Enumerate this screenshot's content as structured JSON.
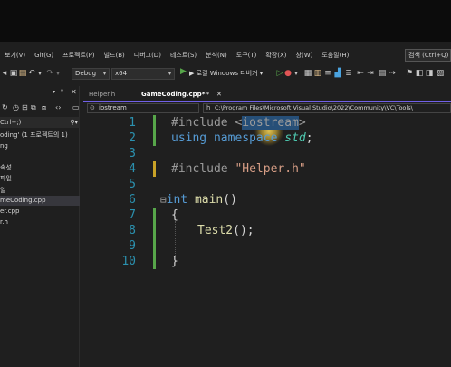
{
  "menubar": {
    "items": [
      "보기(V)",
      "Git(G)",
      "프로젝트(P)",
      "빌드(B)",
      "디버그(D)",
      "테스트(S)",
      "분석(N)",
      "도구(T)",
      "확장(X)",
      "창(W)",
      "도움말(H)"
    ],
    "search_label": "검색 (Ctrl+Q)"
  },
  "toolbar": {
    "config": "Debug",
    "platform": "x64",
    "run_label": "▶ 로컬 Windows 디버거 ▾"
  },
  "solution_explorer": {
    "search_text": "Ctrl+;)",
    "items": [
      "oding' (1 프로젝트의 1)",
      "ng",
      "속성",
      "파일",
      "일",
      "meCoding.cpp",
      "er.cpp",
      "r.h"
    ],
    "selected_index": 5
  },
  "tabs": [
    {
      "label": "Helper.h",
      "active": false
    },
    {
      "label": "GameCoding.cpp*",
      "active": true
    }
  ],
  "navbar": {
    "scope": "iostream",
    "path": "C:\\Program Files\\Microsoft Visual Studio\\2022\\Community\\VC\\Tools\\"
  },
  "editor": {
    "line_numbers": [
      "1",
      "2",
      "3",
      "4",
      "5",
      "6",
      "7",
      "8",
      "9",
      "10"
    ],
    "line1": {
      "directive": "#include ",
      "open": "<",
      "header": "iostream",
      "close": ">"
    },
    "line2": {
      "kw": "using",
      "sp": " ",
      "kw2": "namespace",
      "sp2": " ",
      "ns": "std",
      "semi": ";"
    },
    "line4": {
      "directive": "#include ",
      "str": "\"Helper.h\""
    },
    "line6": {
      "fold": "⊟",
      "type": "int",
      "sp": " ",
      "fn": "main",
      "parens": "()"
    },
    "line7": {
      "brace": "{"
    },
    "line9": {
      "call": "Test2",
      "rest": "();"
    },
    "line10": {
      "brace": "}"
    }
  },
  "colors": {
    "accent": "#7160e8",
    "line_number": "#2b91af",
    "change_saved": "#57a64a",
    "change_unsaved": "#c9a227"
  }
}
